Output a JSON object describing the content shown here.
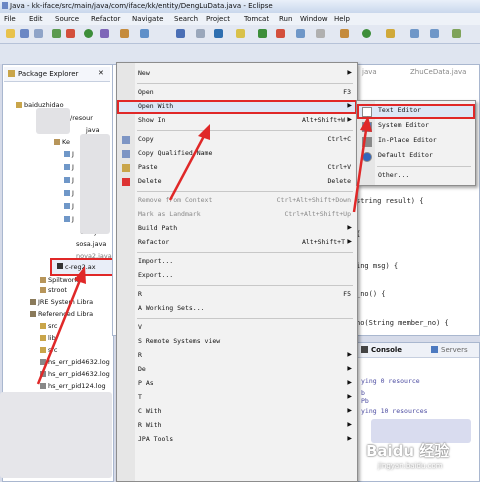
{
  "window_title": "Java - kk-iface/src/main/java/com/iface/kk/entity/DengLuData.java - Eclipse",
  "menubar": [
    "File",
    "Edit",
    "Source",
    "Refactor",
    "Navigate",
    "Search",
    "Project",
    "Tomcat",
    "Run",
    "Window",
    "Help"
  ],
  "package_explorer": {
    "title": "Package Explorer",
    "items": [
      "baiduzhidao",
      "/resour",
      "java",
      "Ke",
      "J",
      "J",
      "J",
      "J",
      "J",
      "J",
      "CSV.jo",
      "sosa.java",
      "nova2.java",
      "c-reg2.ax",
      "Spiltwork",
      "stroot",
      "JRE System Libra",
      "Referenced Libra",
      "src",
      "lib",
      "src",
      "hs_err_pid4632.log",
      "hs_err_pid4632.log",
      "hs_err_pid124.log"
    ]
  },
  "editor": {
    "tabs": [
      "java",
      "ZhuCeData.java"
    ],
    "code": [
      "string result) {",
      "{",
      "ing msg) {",
      "_no() {",
      "no(String member_no) {"
    ]
  },
  "console": {
    "tabs": [
      "Console",
      "Servers"
    ],
    "lines": [
      "ying 0 resource",
      "b",
      "Pb",
      "ying 10 resources"
    ]
  },
  "context_menu": [
    {
      "label": "New",
      "shortcut": "",
      "submenu": true
    },
    {
      "sep": true
    },
    {
      "label": "Open",
      "shortcut": "F3"
    },
    {
      "label": "Open With",
      "shortcut": "",
      "submenu": true,
      "highlight": true
    },
    {
      "label": "Show In",
      "shortcut": "Alt+Shift+W",
      "submenu": true
    },
    {
      "sep": true
    },
    {
      "label": "Copy",
      "shortcut": "Ctrl+C",
      "icon": "copy"
    },
    {
      "label": "Copy Qualified Name",
      "shortcut": "",
      "icon": "copy"
    },
    {
      "label": "Paste",
      "shortcut": "Ctrl+V",
      "icon": "paste"
    },
    {
      "label": "Delete",
      "shortcut": "Delete",
      "icon": "delete"
    },
    {
      "sep": true
    },
    {
      "label": "Remove from Context",
      "shortcut": "Ctrl+Alt+Shift+Down",
      "disabled": true
    },
    {
      "label": "Mark as Landmark",
      "shortcut": "Ctrl+Alt+Shift+Up",
      "disabled": true
    },
    {
      "label": "Build Path",
      "shortcut": "",
      "submenu": true
    },
    {
      "label": "Refactor",
      "shortcut": "Alt+Shift+T",
      "submenu": true
    },
    {
      "sep": true
    },
    {
      "label": "Import...",
      "shortcut": ""
    },
    {
      "label": "Export...",
      "shortcut": ""
    },
    {
      "sep": true
    },
    {
      "label": "R",
      "shortcut": "F5"
    },
    {
      "label": "A  Working Sets...",
      "shortcut": ""
    },
    {
      "sep": true
    },
    {
      "label": "V",
      "shortcut": ""
    },
    {
      "label": "S  Remote Systems view",
      "shortcut": ""
    },
    {
      "label": "R",
      "shortcut": "",
      "submenu": true
    },
    {
      "label": "De",
      "shortcut": "",
      "submenu": true
    },
    {
      "label": "P  As",
      "shortcut": "",
      "submenu": true
    },
    {
      "label": "T",
      "shortcut": "",
      "submenu": true
    },
    {
      "label": "C  With",
      "shortcut": "",
      "submenu": true
    },
    {
      "label": "R  With",
      "shortcut": "",
      "submenu": true
    },
    {
      "label": "JPA Tools",
      "shortcut": "",
      "submenu": true
    }
  ],
  "open_with_submenu": [
    {
      "label": "Text Editor",
      "highlight": true
    },
    {
      "label": "System Editor"
    },
    {
      "label": "In-Place Editor"
    },
    {
      "label": "Default Editor"
    },
    {
      "sep": true
    },
    {
      "label": "Other..."
    }
  ],
  "watermark": "Baidu 经验",
  "watermark_sub": "jingyan.baidu.com",
  "colors": {
    "highlight_box": "#e02828",
    "arrow": "#e02828"
  }
}
